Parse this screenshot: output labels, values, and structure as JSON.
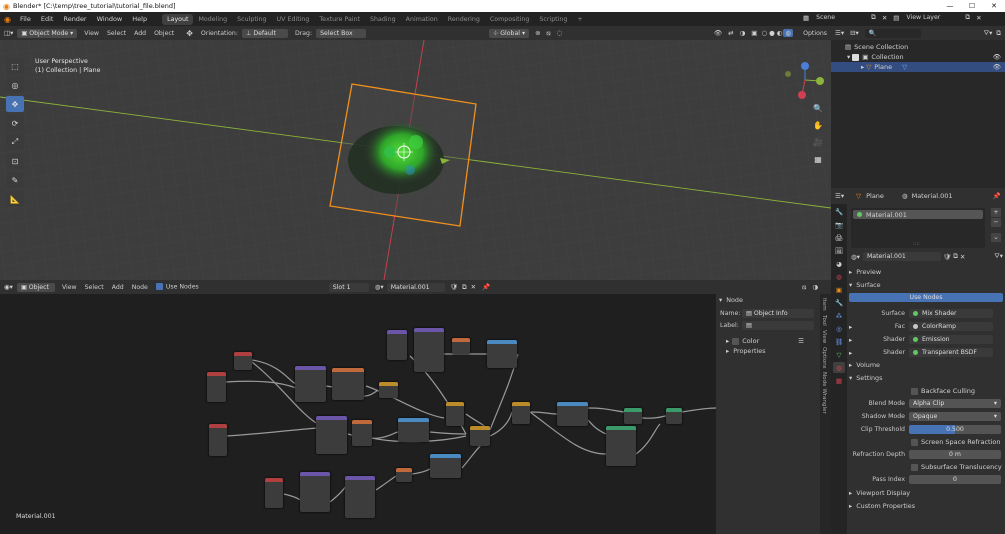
{
  "window": {
    "title": "Blender* [C:\\temp\\tree_tutorial\\tutorial_file.blend]"
  },
  "menu": [
    "File",
    "Edit",
    "Render",
    "Window",
    "Help"
  ],
  "workspaces": [
    "Layout",
    "Modeling",
    "Sculpting",
    "UV Editing",
    "Texture Paint",
    "Shading",
    "Animation",
    "Rendering",
    "Compositing",
    "Scripting"
  ],
  "scene": {
    "name": "Scene",
    "view_layer": "View Layer"
  },
  "viewport_header": {
    "mode": "Object Mode",
    "menus": [
      "View",
      "Select",
      "Add",
      "Object"
    ],
    "orientation_label": "Orientation:",
    "orientation": "Default",
    "drag_label": "Drag:",
    "drag": "Select Box",
    "transform_orientation": "Global",
    "options": "Options"
  },
  "viewport": {
    "info_line1": "User Perspective",
    "info_line2": "(1) Collection | Plane"
  },
  "outliner": {
    "items": [
      {
        "label": "Scene Collection"
      },
      {
        "label": "Collection"
      },
      {
        "label": "Plane"
      }
    ]
  },
  "node_header": {
    "mode": "Object",
    "menus": [
      "View",
      "Select",
      "Add",
      "Node"
    ],
    "use_nodes": "Use Nodes",
    "slot": "Slot 1",
    "material": "Material.001"
  },
  "node_editor": {
    "footer": "Material.001"
  },
  "node_panel": {
    "title": "Node",
    "name_label": "Name:",
    "name_value": "Object Info",
    "label_label": "Label:",
    "label_value": "",
    "color": "Color",
    "properties": "Properties",
    "tabs": [
      "Item",
      "Tool",
      "View",
      "Options",
      "Node Wrangler"
    ]
  },
  "properties": {
    "object": "Plane",
    "material": "Material.001",
    "slot_item": "Material.001",
    "material_field": "Material.001",
    "preview": "Preview",
    "surface": "Surface",
    "use_nodes": "Use Nodes",
    "surface_label": "Surface",
    "surface_value": "Mix Shader",
    "fac_label": "Fac",
    "fac_value": "ColorRamp",
    "shader1_label": "Shader",
    "shader1_value": "Emission",
    "shader2_label": "Shader",
    "shader2_value": "Transparent BSDF",
    "volume": "Volume",
    "settings": "Settings",
    "backface_culling": "Backface Culling",
    "blend_mode_label": "Blend Mode",
    "blend_mode": "Alpha Clip",
    "shadow_mode_label": "Shadow Mode",
    "shadow_mode": "Opaque",
    "clip_threshold_label": "Clip Threshold",
    "clip_threshold": "0.500",
    "ssr": "Screen Space Refraction",
    "refraction_depth_label": "Refraction Depth",
    "refraction_depth": "0 m",
    "subsurface": "Subsurface Translucency",
    "pass_index_label": "Pass Index",
    "pass_index": "0",
    "viewport_display": "Viewport Display",
    "custom_properties": "Custom Properties"
  },
  "colors": {
    "accent": "#4772b3",
    "selection_orange": "#f0901c",
    "x_axis": "#d04050",
    "y_axis": "#8bb43a"
  }
}
